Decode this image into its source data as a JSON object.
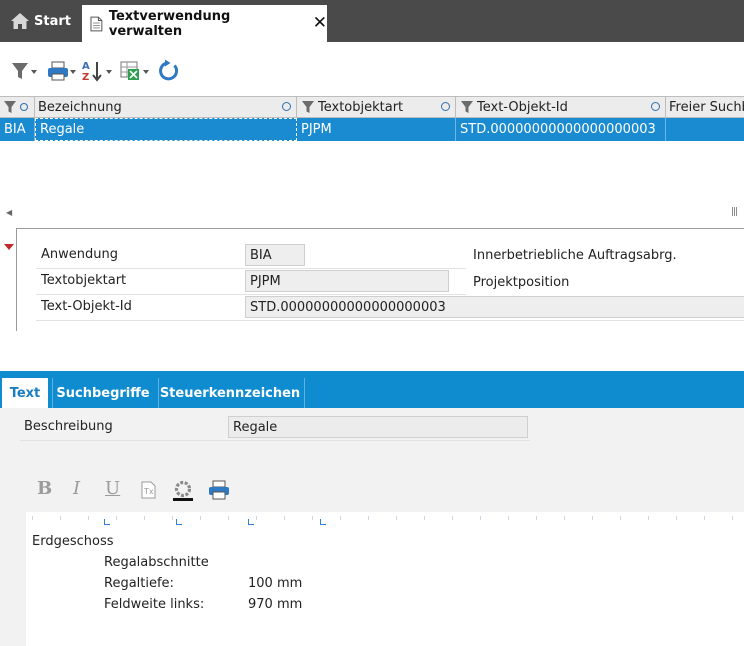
{
  "tabs": {
    "start_label": "Start",
    "active_label": "Textverwendung verwalten"
  },
  "grid": {
    "columns": [
      "Bezeichnung",
      "Textobjektart",
      "Text-Objekt-Id",
      "Freier Suchb"
    ],
    "row": {
      "app": "BIA",
      "bezeichnung": "Regale",
      "textobjektart": "PJPM",
      "textobjektid": "STD.00000000000000000003"
    }
  },
  "detail": {
    "anwendung_label": "Anwendung",
    "anwendung_value": "BIA",
    "anwendung_desc": "Innerbetriebliche Auftragsabrg.",
    "textobjektart_label": "Textobjektart",
    "textobjektart_value": "PJPM",
    "textobjektart_desc": "Projektposition",
    "textobjektid_label": "Text-Objekt-Id",
    "textobjektid_value": "STD.00000000000000000003"
  },
  "subtabs": {
    "text": "Text",
    "suchbegriffe": "Suchbegriffe",
    "steuerkennzeichen": "Steuerkennzeichen"
  },
  "form": {
    "beschreibung_label": "Beschreibung",
    "beschreibung_value": "Regale"
  },
  "editor": {
    "bold_glyph": "B",
    "italic_glyph": "I",
    "underline_glyph": "U",
    "line1": "Erdgeschoss",
    "line2": "Regalabschnitte",
    "line3_label": "Regaltiefe:",
    "line3_value": "100 mm",
    "line4_label": "Feldweite links:",
    "line4_value": "970 mm"
  },
  "colors": {
    "tabbar": "#4a4a4a",
    "selection": "#1a8bd0",
    "tabstrip": "#0f8bd0"
  }
}
